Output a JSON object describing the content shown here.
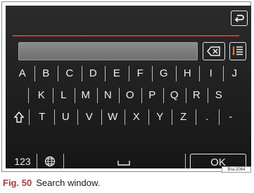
{
  "keyboard": {
    "row1": [
      "A",
      "B",
      "C",
      "D",
      "E",
      "F",
      "G",
      "H",
      "I",
      "J"
    ],
    "row2": [
      "K",
      "L",
      "M",
      "N",
      "O",
      "P",
      "Q",
      "R",
      "S"
    ],
    "row3": [
      "T",
      "U",
      "V",
      "W",
      "X",
      "Y",
      "Z",
      ".",
      "-"
    ],
    "mode_label": "123",
    "ok_label": "OK"
  },
  "code_tag": "Bra-2064",
  "caption": {
    "fig": "Fig. 50",
    "text": "Search window."
  },
  "colors": {
    "accent_line": "#c83a33",
    "screen_bg": "#1f1f1f",
    "key_text": "#f0f0f0"
  },
  "icons": [
    "back-icon",
    "backspace-icon",
    "list-icon",
    "shift-icon",
    "globe-icon",
    "space-icon"
  ]
}
